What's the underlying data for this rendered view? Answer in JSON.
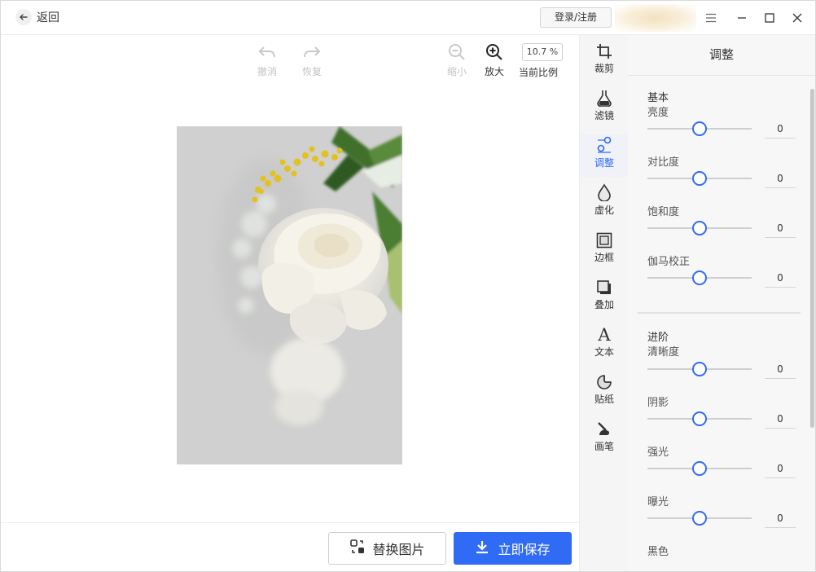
{
  "header": {
    "back_label": "返回",
    "login_label": "登录/注册"
  },
  "toolbar": {
    "undo": "撤消",
    "redo": "恢复",
    "zoom_out": "缩小",
    "zoom_in": "放大",
    "zoom_value": "10.7 %",
    "zoom_caption": "当前比例"
  },
  "bottom": {
    "replace_label": "替换图片",
    "save_label": "立即保存"
  },
  "rail": [
    {
      "label": "裁剪",
      "icon": "crop-icon"
    },
    {
      "label": "滤镜",
      "icon": "flask-icon"
    },
    {
      "label": "调整",
      "icon": "adjust-icon"
    },
    {
      "label": "虚化",
      "icon": "drop-icon"
    },
    {
      "label": "边框",
      "icon": "frame-icon"
    },
    {
      "label": "叠加",
      "icon": "overlay-icon"
    },
    {
      "label": "文本",
      "icon": "text-icon"
    },
    {
      "label": "贴纸",
      "icon": "sticker-icon"
    },
    {
      "label": "画笔",
      "icon": "brush-icon"
    }
  ],
  "panel": {
    "title": "调整",
    "basic_title": "基本",
    "advanced_title": "进阶",
    "basic": [
      {
        "label": "亮度",
        "value": "0",
        "level": 0.5
      },
      {
        "label": "对比度",
        "value": "0",
        "level": 0.5
      },
      {
        "label": "饱和度",
        "value": "0",
        "level": 0.5
      },
      {
        "label": "伽马校正",
        "value": "0",
        "level": 0.5
      }
    ],
    "advanced": [
      {
        "label": "清晰度",
        "value": "0",
        "level": 0.5
      },
      {
        "label": "阴影",
        "value": "0",
        "level": 0.5
      },
      {
        "label": "强光",
        "value": "0",
        "level": 0.5
      },
      {
        "label": "曝光",
        "value": "0",
        "level": 0.5
      },
      {
        "label": "黑色"
      }
    ]
  },
  "colors": {
    "accent": "#2f6bf5"
  }
}
